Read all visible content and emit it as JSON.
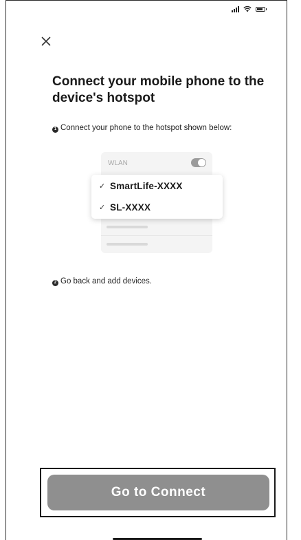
{
  "status_bar": {
    "signal_icon": "cellular-signal-icon",
    "wifi_icon": "wifi-icon",
    "battery_icon": "battery-icon"
  },
  "header": {
    "close_icon": "close-icon"
  },
  "title": "Connect your mobile phone to the device's hotspot",
  "steps": [
    {
      "number": "1",
      "text": "Connect your phone to the hotspot shown below:"
    },
    {
      "number": "2",
      "text": "Go back and add devices."
    }
  ],
  "illustration": {
    "wlan_label": "WLAN",
    "wlan_enabled": true,
    "networks": [
      {
        "check": "✓",
        "ssid": "SmartLife-XXXX"
      },
      {
        "check": "✓",
        "ssid": "SL-XXXX"
      }
    ]
  },
  "primary_action": {
    "label": "Go to Connect",
    "button_color": "#8f8f8f",
    "highlight_border_color": "#1a1a1a"
  }
}
